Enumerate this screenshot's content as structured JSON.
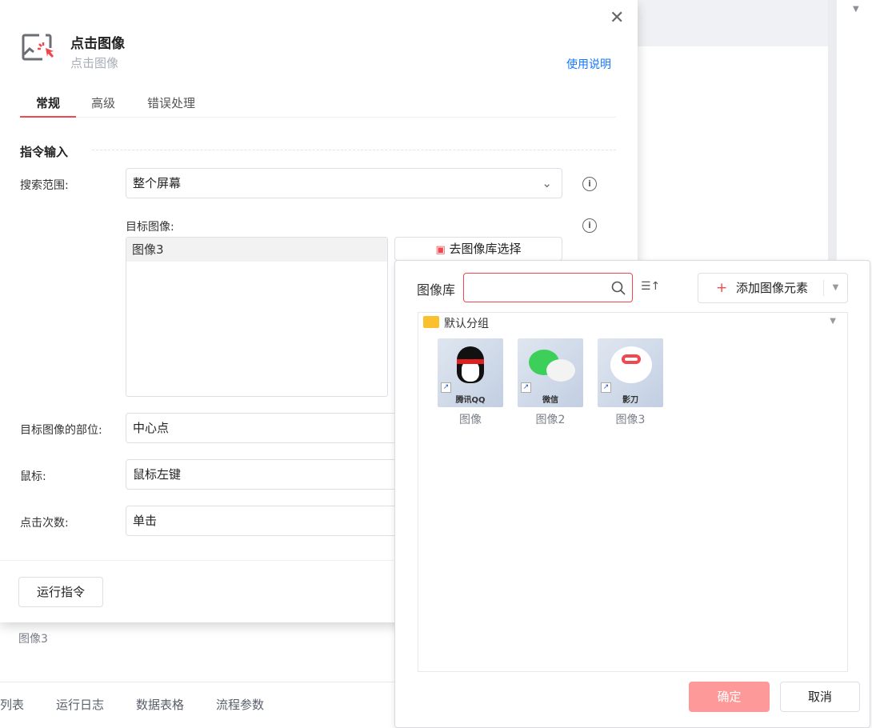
{
  "modal": {
    "title": "点击图像",
    "subtitle": "点击图像",
    "help_link": "使用说明",
    "tabs": [
      "常规",
      "高级",
      "错误处理"
    ],
    "section": "指令输入",
    "search_range": {
      "label": "搜索范围:",
      "value": "整个屏幕"
    },
    "target_image": {
      "label": "目标图像:",
      "selected": "图像3",
      "library_button": "去图像库选择"
    },
    "image_part": {
      "label": "目标图像的部位:",
      "value": "中心点"
    },
    "mouse": {
      "label": "鼠标:",
      "value": "鼠标左键"
    },
    "click_count": {
      "label": "点击次数:",
      "value": "单击"
    },
    "run_button": "运行指令"
  },
  "background": {
    "item_label": "图像3",
    "bottom_tabs": [
      "列表",
      "运行日志",
      "数据表格",
      "流程参数"
    ]
  },
  "library": {
    "label": "图像库",
    "search_value": "",
    "add_button": "添加图像元素",
    "group": "默认分组",
    "images": [
      {
        "name": "图像",
        "icon_text": "腾讯QQ"
      },
      {
        "name": "图像2",
        "icon_text": "微信"
      },
      {
        "name": "图像3",
        "icon_text": "影刀"
      }
    ],
    "confirm": "确定",
    "cancel": "取消"
  },
  "colors": {
    "accent": "#f0484e",
    "link": "#1677ff",
    "confirm_bg": "#fe9999"
  }
}
